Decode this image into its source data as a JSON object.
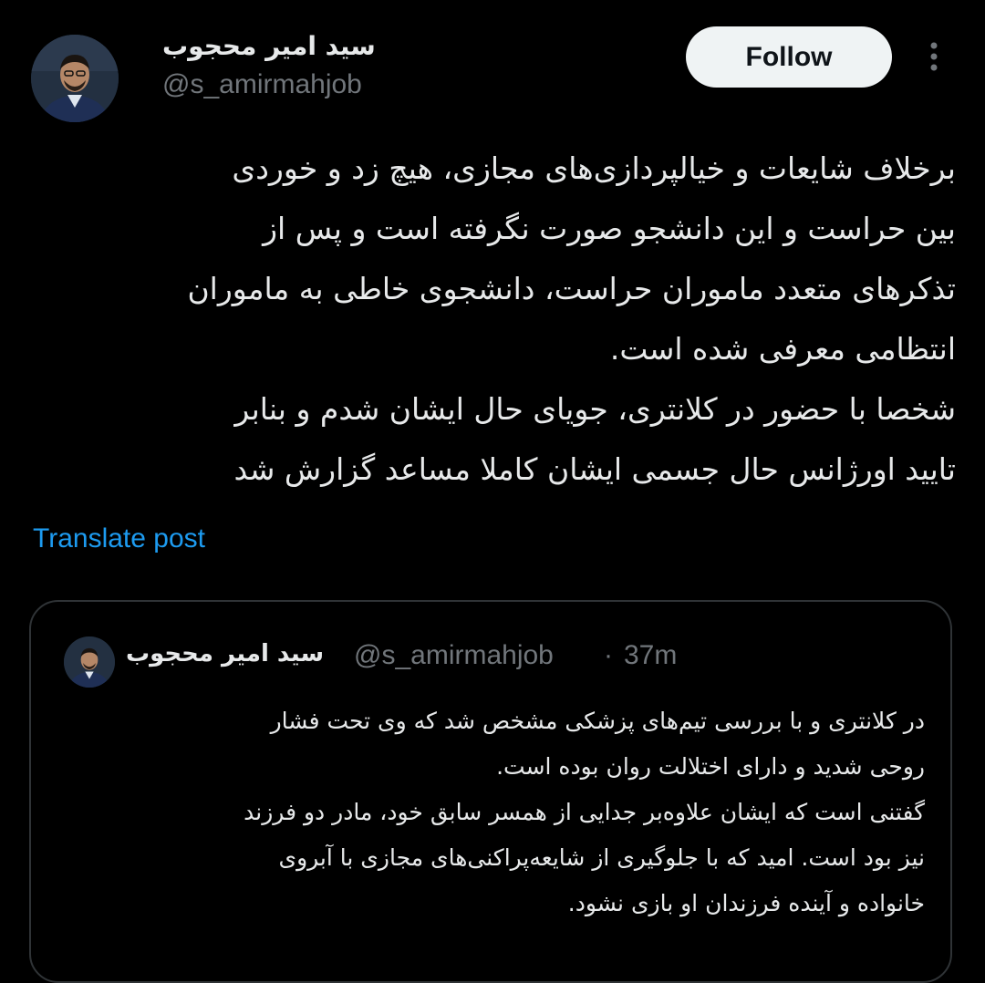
{
  "author": {
    "display_name": "سید امیر محجوب",
    "handle": "@s_amirmahjob",
    "avatar_icon": "user-avatar-photo"
  },
  "actions": {
    "follow_label": "Follow",
    "more_icon": "more-vertical-icon"
  },
  "post": {
    "lines": [
      "برخلاف شایعات و خیالپردازی‌های مجازی، هیچ زد و خوردی",
      "بین حراست و این دانشجو صورت نگرفته است و پس از",
      "تذکرهای متعدد ماموران حراست، دانشجوی خاطی به ماموران",
      "انتظامی معرفی شده است.",
      "شخصا با حضور در کلانتری، جویای حال ایشان شدم و بنابر",
      "تایید اورژانس حال جسمی ایشان کاملا مساعد گزارش شد"
    ],
    "translate_label": "Translate post"
  },
  "quoted": {
    "display_name": "سید امیر محجوب",
    "handle": "@s_amirmahjob",
    "separator": "·",
    "time": "37m",
    "lines": [
      "در کلانتری و با بررسی تیم‌های پزشکی مشخص شد که وی تحت فشار",
      "روحی شدید و دارای اختلالت روان بوده است.",
      "گفتنی است که ایشان علاوه‌بر جدایی از همسر سابق خود، مادر دو فرزند",
      "نیز بود است. امید که با جلوگیری از شایعه‌پراکنی‌های مجازی با آبروی",
      "خانواده و آینده فرزندان او بازی نشود."
    ]
  },
  "colors": {
    "background": "#000000",
    "text": "#e7e9ea",
    "muted": "#71767b",
    "link": "#1d9bf0",
    "border": "#2f3336",
    "button_bg": "#eff3f4"
  }
}
